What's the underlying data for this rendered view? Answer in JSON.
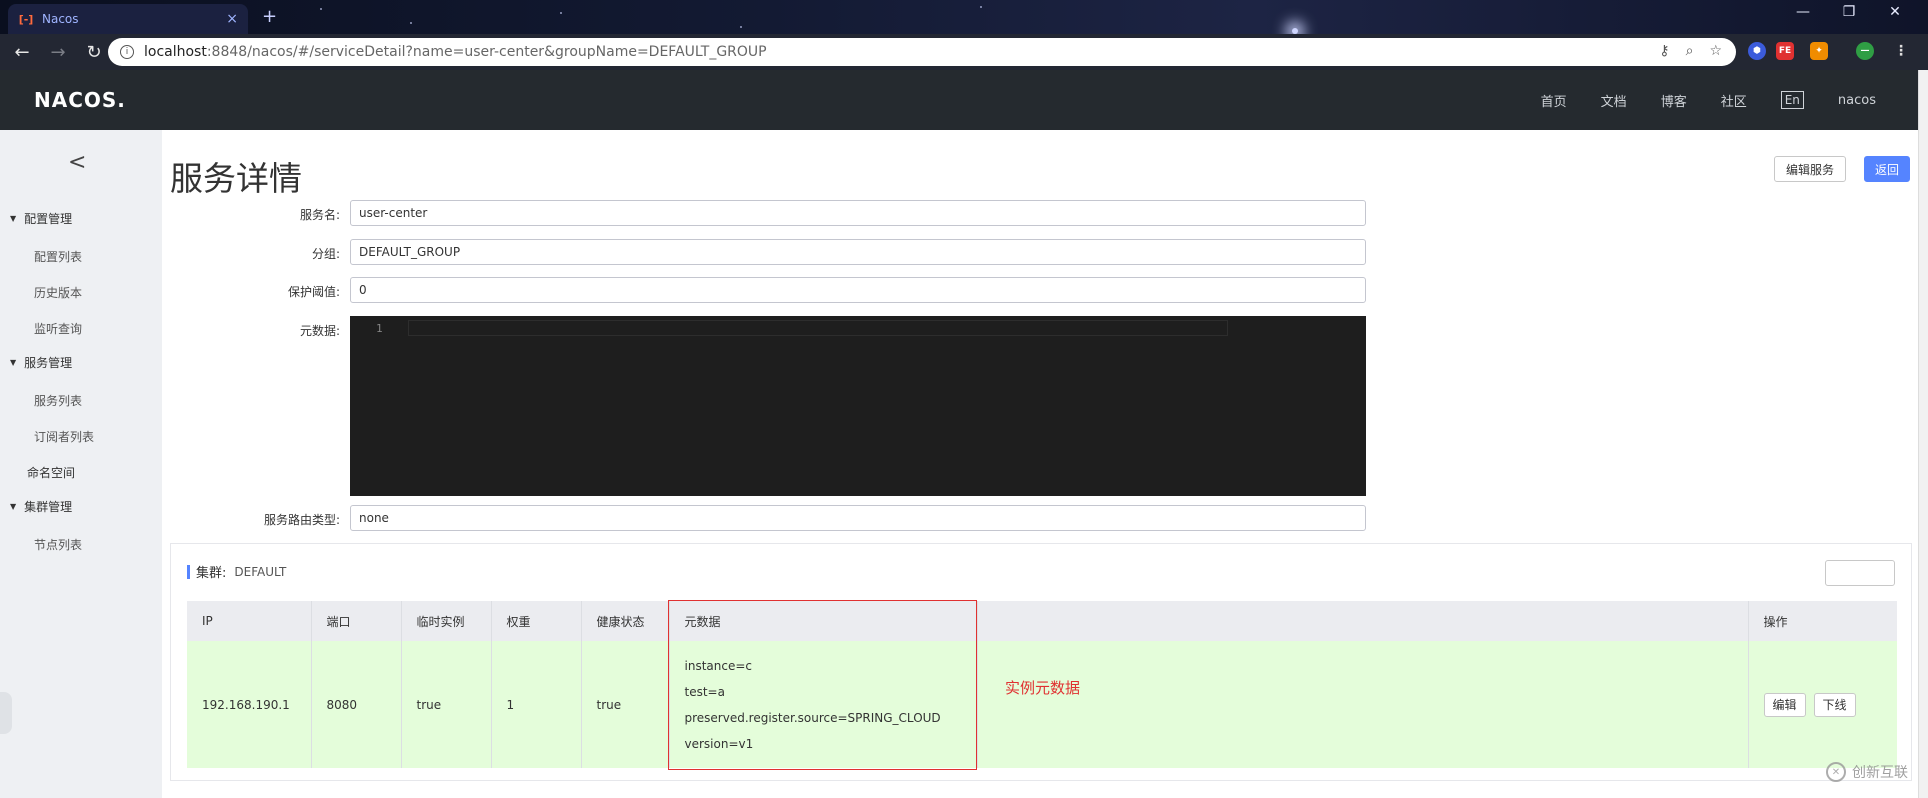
{
  "browser": {
    "tab_title": "Nacos",
    "tab_close": "×",
    "new_tab": "+",
    "url_host": "localhost",
    "url_rest": ":8848/nacos/#/serviceDetail?name=user-center&groupName=DEFAULT_GROUP",
    "window_controls": [
      "—",
      "❐",
      "✕"
    ],
    "extensions": [
      "FE"
    ]
  },
  "header": {
    "logo": "NACOS.",
    "nav": [
      "首页",
      "文档",
      "博客",
      "社区"
    ],
    "lang": "En",
    "user": "nacos"
  },
  "sidebar": {
    "groups": [
      {
        "label": "配置管理",
        "items": [
          "配置列表",
          "历史版本",
          "监听查询"
        ]
      },
      {
        "label": "服务管理",
        "items": [
          "服务列表",
          "订阅者列表"
        ]
      }
    ],
    "namespace": "命名空间",
    "cluster_group": {
      "label": "集群管理",
      "items": [
        "节点列表"
      ]
    }
  },
  "page": {
    "title": "服务详情",
    "edit_service": "编辑服务",
    "back": "返回"
  },
  "form": {
    "service_name_label": "服务名:",
    "service_name": "user-center",
    "group_label": "分组:",
    "group": "DEFAULT_GROUP",
    "threshold_label": "保护阈值:",
    "threshold": "0",
    "metadata_label": "元数据:",
    "editor_line": "1",
    "route_type_label": "服务路由类型:",
    "route_type": "none"
  },
  "cluster": {
    "label": "集群:",
    "name": "DEFAULT",
    "config_button": "",
    "columns": [
      "IP",
      "端口",
      "临时实例",
      "权重",
      "健康状态",
      "元数据",
      "",
      "操作"
    ],
    "rows": [
      {
        "ip": "192.168.190.1",
        "port": "8080",
        "ephemeral": "true",
        "weight": "1",
        "healthy": "true",
        "metadata": [
          "instance=c",
          "test=a",
          "preserved.register.source=SPRING_CLOUD",
          "version=v1"
        ],
        "edit": "编辑",
        "offline": "下线"
      }
    ]
  },
  "annotation": "实例元数据",
  "watermark": "创新互联"
}
